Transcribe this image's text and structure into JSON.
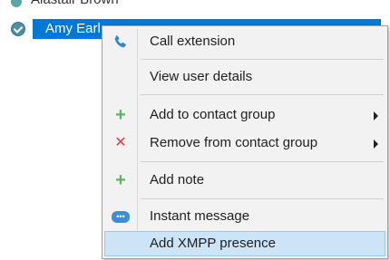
{
  "contacts": {
    "previous_name": "Alastair Brown",
    "selected_name": "Amy Earl"
  },
  "menu": {
    "items": [
      {
        "label": "Call extension",
        "icon": "phone-icon"
      },
      {
        "label": "View user details",
        "icon": ""
      },
      {
        "label": "Add to contact group",
        "icon": "plus-icon",
        "submenu": true
      },
      {
        "label": "Remove from contact group",
        "icon": "x-icon",
        "submenu": true
      },
      {
        "label": "Add note",
        "icon": "plus-icon"
      },
      {
        "label": "Instant message",
        "icon": "chat-icon"
      },
      {
        "label": "Add XMPP presence",
        "icon": "",
        "highlighted": true
      }
    ],
    "icons": {
      "plus": "+",
      "x": "✕"
    },
    "colors": {
      "selection": "#0078d7",
      "highlight": "#cce4f7",
      "plus": "#5fb45f",
      "remove": "#e03c3c",
      "chat": "#3b8fd9"
    }
  }
}
